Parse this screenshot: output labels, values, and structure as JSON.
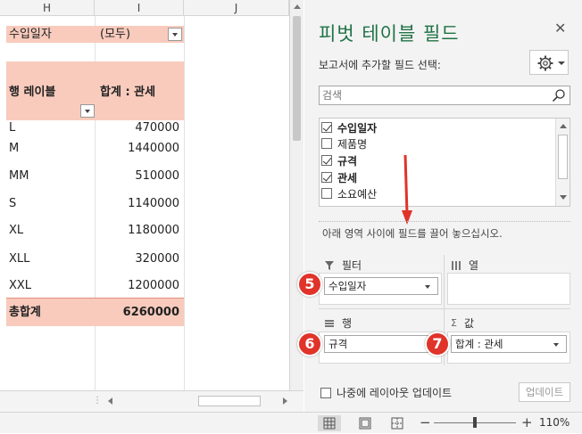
{
  "sheet": {
    "columns": [
      "H",
      "I",
      "J"
    ],
    "filter_row": {
      "label": "수입일자",
      "value": "(모두)"
    },
    "pivot_header": {
      "row_label": "행 레이블",
      "value_label": "합계 : 관세"
    },
    "rows": [
      {
        "label": "L",
        "value": "470000"
      },
      {
        "label": "M",
        "value": "1440000"
      },
      {
        "label": "MM",
        "value": "510000"
      },
      {
        "label": "S",
        "value": "1140000"
      },
      {
        "label": "XL",
        "value": "1180000"
      },
      {
        "label": "XLL",
        "value": "320000"
      },
      {
        "label": "XXL",
        "value": "1200000"
      }
    ],
    "total": {
      "label": "총합계",
      "value": "6260000"
    }
  },
  "pane": {
    "title": "피벗 테이블 필드",
    "subtitle": "보고서에 추가할 필드 선택:",
    "search_placeholder": "검색",
    "fields": [
      {
        "name": "수입일자",
        "checked": true
      },
      {
        "name": "제품명",
        "checked": false
      },
      {
        "name": "규격",
        "checked": true
      },
      {
        "name": "관세",
        "checked": true
      },
      {
        "name": "소요예산",
        "checked": false
      }
    ],
    "drag_hint": "아래 영역 사이에 필드를 끌어 놓으십시오.",
    "areas": {
      "filters": {
        "label": "필터",
        "pill": "수입일자"
      },
      "columns": {
        "label": "열"
      },
      "rows": {
        "label": "행",
        "pill": "규격"
      },
      "values": {
        "label": "값",
        "pill": "합계 : 관세"
      }
    },
    "defer_label": "나중에 레이아웃 업데이트",
    "update_button": "업데이트"
  },
  "badges": [
    "5",
    "6",
    "7"
  ],
  "status": {
    "zoom": "110%"
  },
  "colors": {
    "pink": "#f8cbbd",
    "accent": "#217346",
    "badge": "#e0332a",
    "arrow": "#e0332a"
  }
}
